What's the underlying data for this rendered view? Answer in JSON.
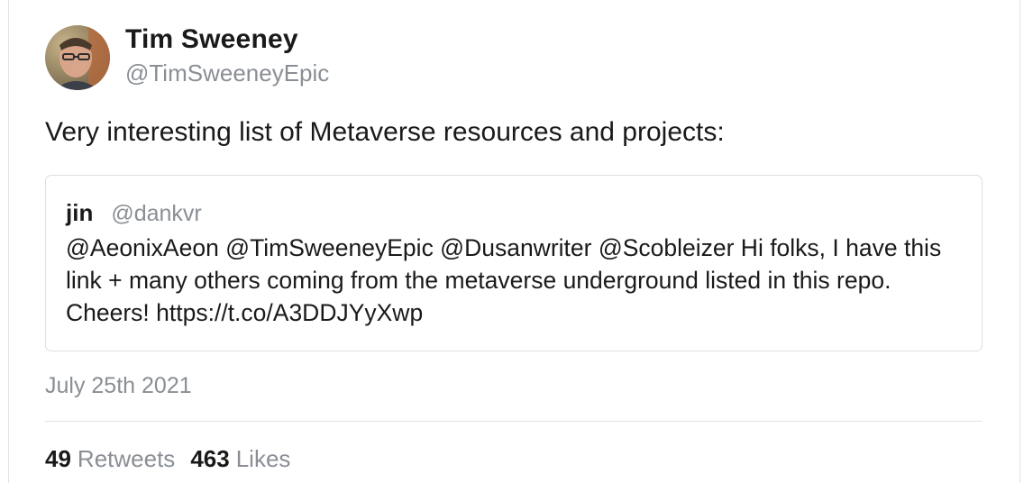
{
  "tweet": {
    "author": {
      "display_name": "Tim Sweeney",
      "handle": "@TimSweeneyEpic",
      "avatar_icon": "profile-photo"
    },
    "text": "Very interesting list of Metaverse resources and projects:",
    "quoted": {
      "author_name": "jin",
      "author_handle": "@dankvr",
      "text": "@AeonixAeon @TimSweeneyEpic @Dusanwriter @Scobleizer Hi folks, I have this link + many others coming from the metaverse underground listed in this repo. Cheers! https://t.co/A3DDJYyXwp"
    },
    "date": "July 25th 2021",
    "stats": {
      "retweets_count": "49",
      "retweets_label": "Retweets",
      "likes_count": "463",
      "likes_label": "Likes"
    }
  },
  "colors": {
    "text_primary": "#1a1a1a",
    "text_secondary": "#8a8f95",
    "border": "#dedede",
    "background": "#ffffff"
  }
}
